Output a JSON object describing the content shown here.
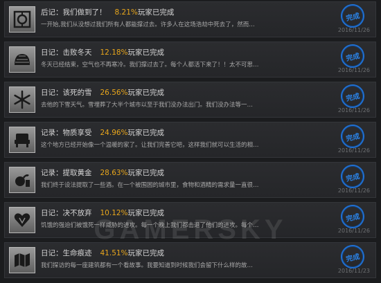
{
  "watermark": "GAMERSKY",
  "pct_suffix": "玩家已完成",
  "stamp_label": "完成",
  "achievements": [
    {
      "title": "后记：我们做到了！",
      "percent": "8.21%",
      "desc": "一开始,我们从没想过我们所有人都能撑过去。许多人在这场浩劫中死去了，然而…",
      "date": "2016/11/26",
      "icon": "target-icon"
    },
    {
      "title": "日记：击败冬天",
      "percent": "12.18%",
      "desc": "冬天已经结束，空气也不再寒冷。我们撑过去了。每个人都活下来了！！太不可思…",
      "date": "2016/11/26",
      "icon": "shelter-icon"
    },
    {
      "title": "日记：该死的雪",
      "percent": "26.56%",
      "desc": "去他的下雪天气。雪埋葬了大半个城市以至于我们没办法出门。我们没办法等一…",
      "date": "2016/11/26",
      "icon": "snowflake-icon"
    },
    {
      "title": "记录：物质享受",
      "percent": "24.96%",
      "desc": "这个地方已经开始像一个温暖的家了。让我们完善它吧，这样我们就可以生活的相…",
      "date": "2016/11/26",
      "icon": "chair-icon"
    },
    {
      "title": "记录：提取黄金",
      "percent": "28.63%",
      "desc": "我们终于设法提取了一些酒。在一个被围困的城市里，食物和酒精的需求量一直很…",
      "date": "2016/11/26",
      "icon": "still-icon"
    },
    {
      "title": "日记：决不放弃",
      "percent": "10.12%",
      "desc": "饥饿的强迫们被饿死一样威胁的进攻。每一个晚上我们都击退了他们的进攻。每个…",
      "date": "2016/11/26",
      "icon": "heart-icon"
    },
    {
      "title": "日记：生命痕迹",
      "percent": "41.51%",
      "desc": "我们探访的每一座建筑都有一个看故事。我要知道到时候我们会留下什么样的故…",
      "date": "2016/11/23",
      "icon": "map-icon"
    }
  ]
}
